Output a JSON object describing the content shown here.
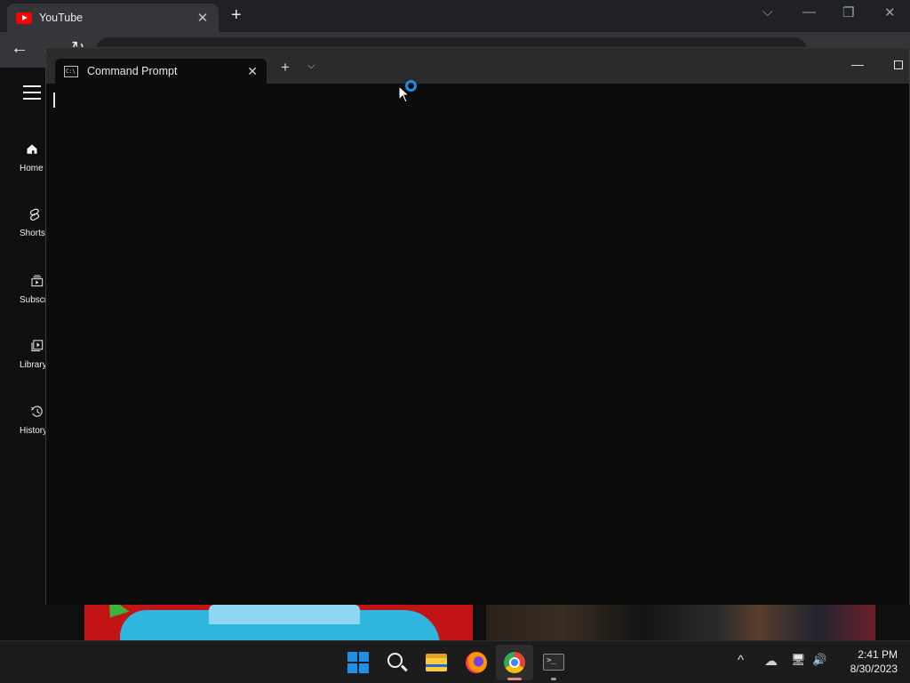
{
  "browser": {
    "tab_title": "YouTube",
    "tab_close": "✕",
    "new_tab": "+",
    "window_controls": {
      "dropdown": "⌵",
      "minimize": "—",
      "restore": "❐",
      "close": "✕"
    },
    "toolbar": {
      "back": "←",
      "forward": "→",
      "reload": "↻"
    }
  },
  "youtube": {
    "nav": [
      {
        "label": "Home",
        "icon": "home-icon"
      },
      {
        "label": "Shorts",
        "icon": "shorts-icon"
      },
      {
        "label": "Subscriptions",
        "icon": "subscriptions-icon"
      },
      {
        "label": "Library",
        "icon": "library-icon"
      },
      {
        "label": "History",
        "icon": "history-icon"
      }
    ]
  },
  "terminal": {
    "tab_title": "Command Prompt",
    "tab_icon_text": "C:\\",
    "tab_close": "✕",
    "new_tab": "+",
    "dropdown": "⌵",
    "minimize": "—"
  },
  "taskbar": {
    "apps": [
      "start",
      "search",
      "file-explorer",
      "firefox",
      "chrome",
      "terminal"
    ],
    "terminal_icon_text": ">_",
    "tray": {
      "chevron": "^",
      "cloud": "☁",
      "network": "🖥",
      "volume": "🔊"
    },
    "clock": {
      "time": "2:41 PM",
      "date": "8/30/2023"
    }
  },
  "colors": {
    "accent_start": "#1e90e8",
    "youtube_red": "#ff0000",
    "busy_ring": "#1b8de3"
  }
}
